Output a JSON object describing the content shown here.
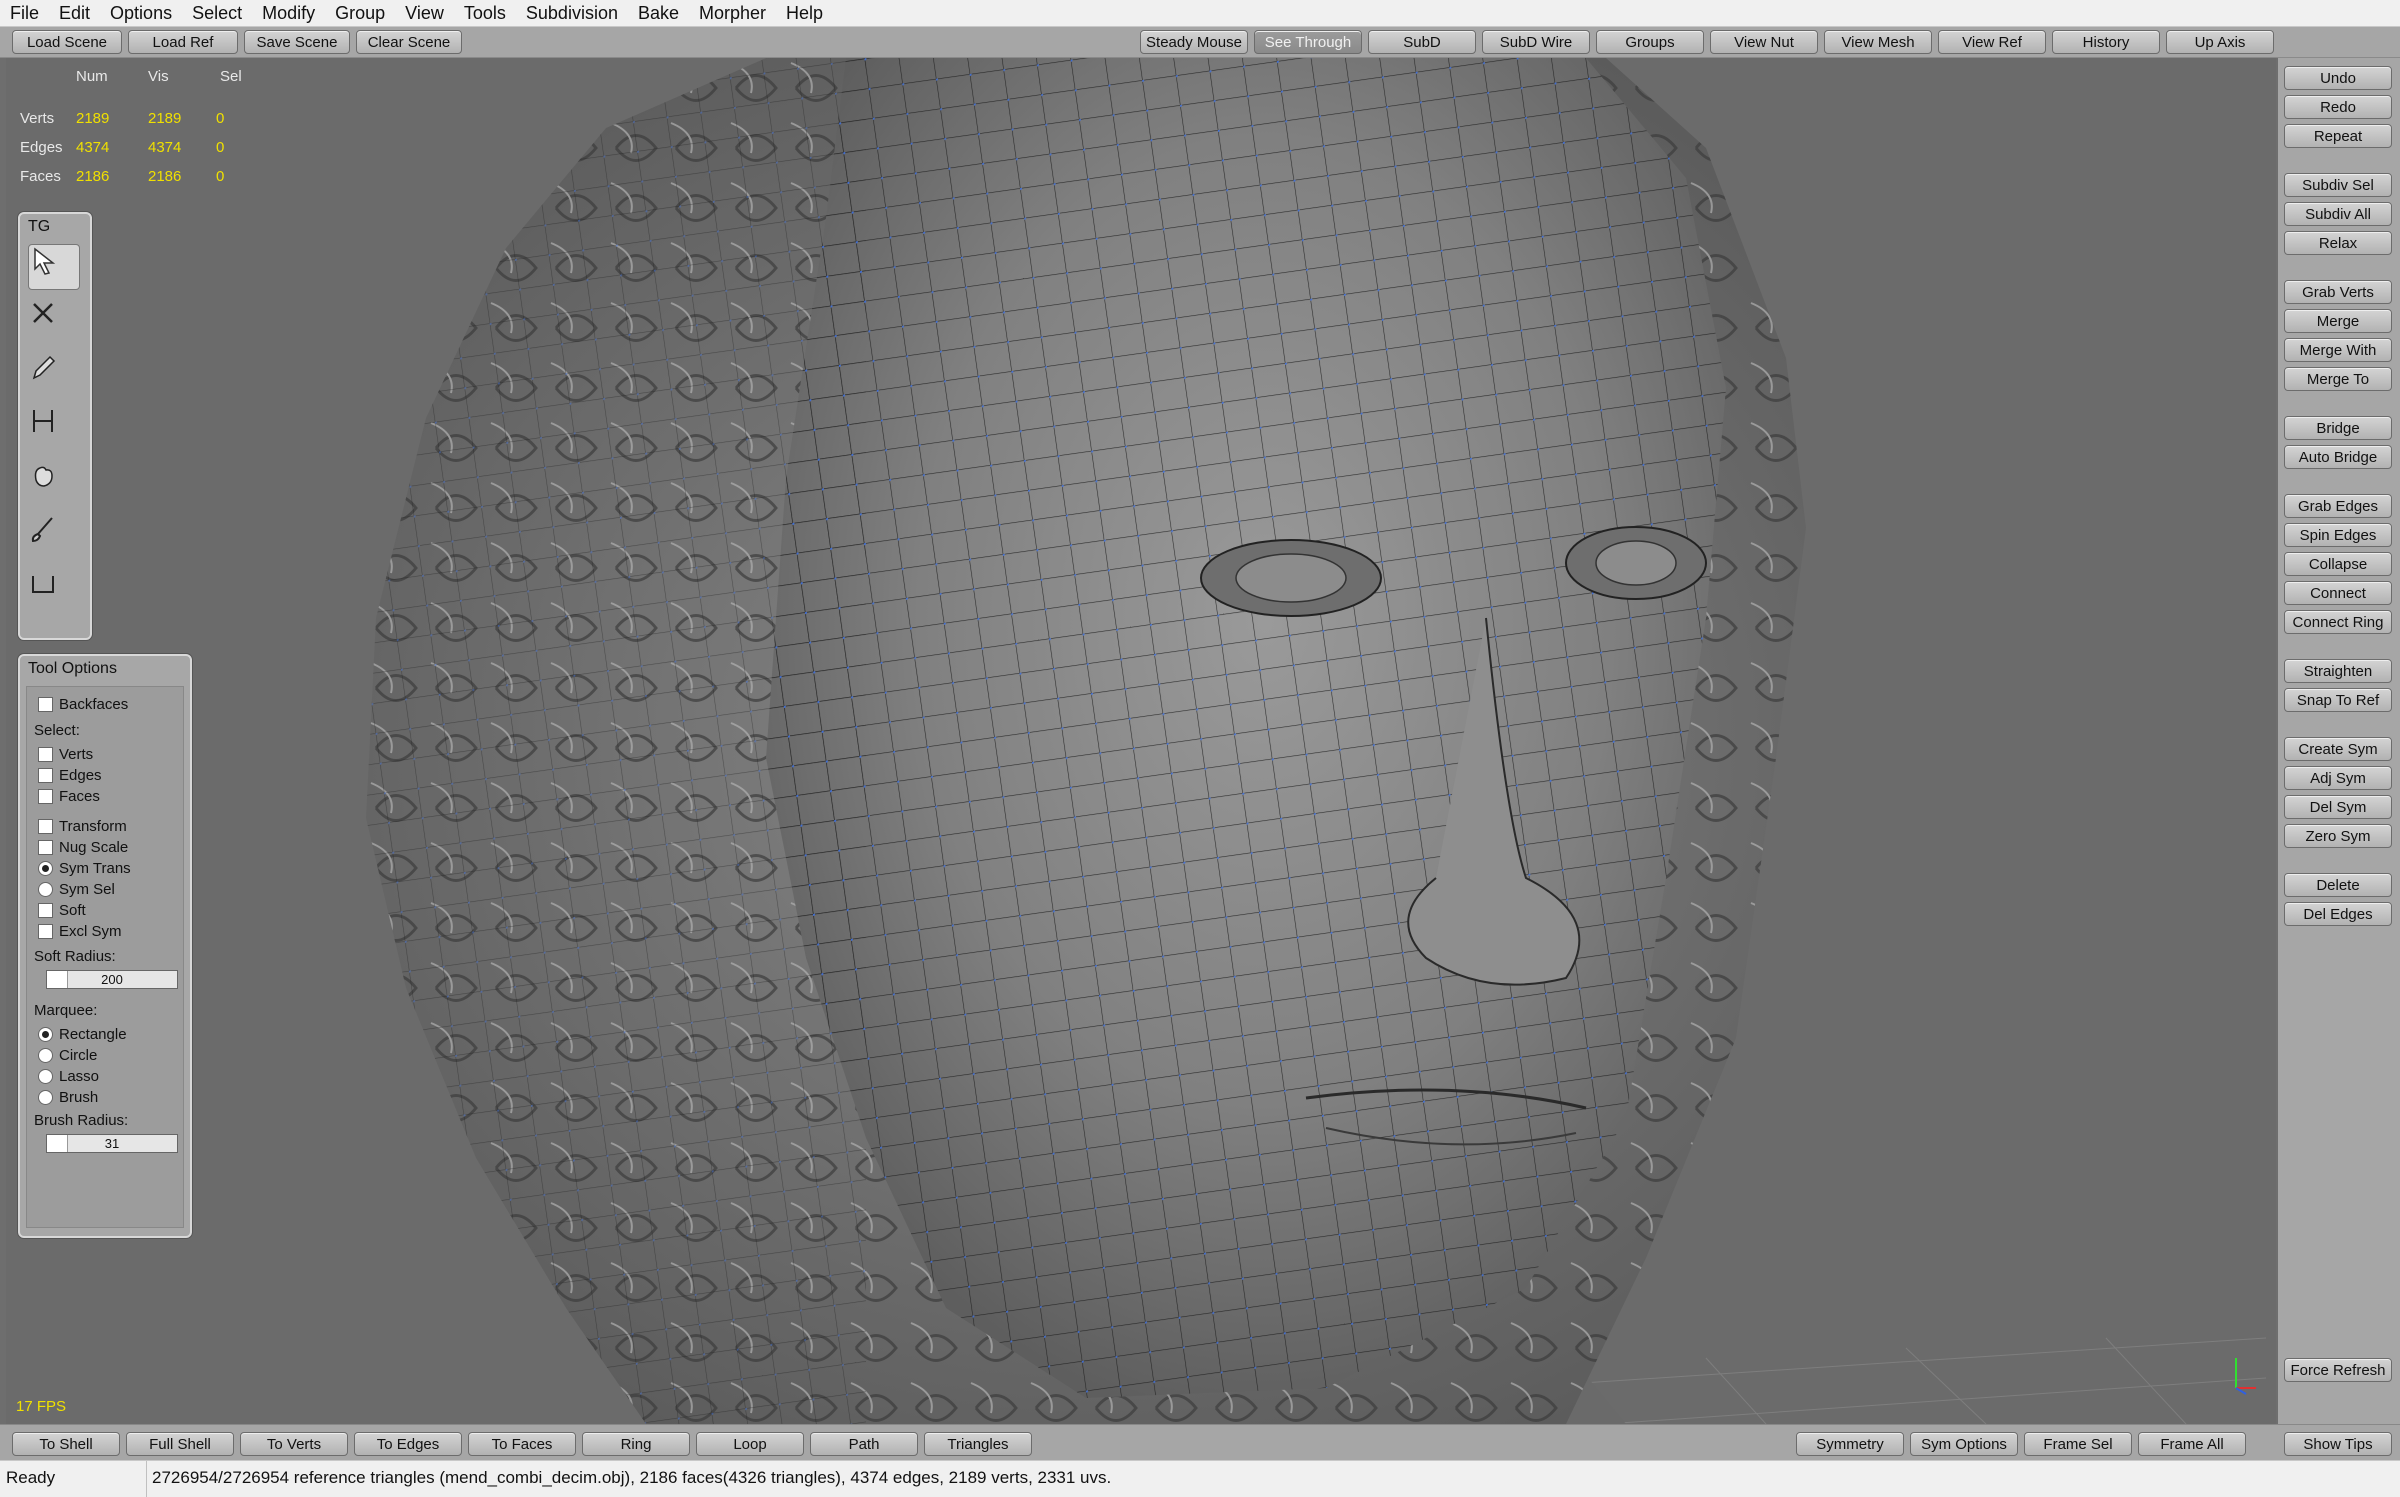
{
  "menu": [
    "File",
    "Edit",
    "Options",
    "Select",
    "Modify",
    "Group",
    "View",
    "Tools",
    "Subdivision",
    "Bake",
    "Morpher",
    "Help"
  ],
  "scene_buttons": [
    "Load Scene",
    "Load Ref",
    "Save Scene",
    "Clear Scene"
  ],
  "view_toggles": [
    "Steady Mouse",
    "See Through",
    "SubD",
    "SubD Wire",
    "Groups",
    "View Nut",
    "View Mesh",
    "View Ref",
    "History",
    "Up Axis"
  ],
  "stats": {
    "headers": [
      "Num",
      "Vis",
      "Sel"
    ],
    "rows": [
      {
        "label": "Verts",
        "num": "2189",
        "vis": "2189",
        "sel": "0"
      },
      {
        "label": "Edges",
        "num": "4374",
        "vis": "4374",
        "sel": "0"
      },
      {
        "label": "Faces",
        "num": "2186",
        "vis": "2186",
        "sel": "0"
      }
    ]
  },
  "fps": "17 FPS",
  "tool_panel": {
    "title": "TG",
    "tools": [
      "select-arrow-icon",
      "cross-icon",
      "pencil-icon",
      "bridge-tool-icon",
      "hand-tool-icon",
      "brush-tool-icon",
      "measure-tool-icon"
    ]
  },
  "tool_options": {
    "title": "Tool Options",
    "backfaces": "Backfaces",
    "select_label": "Select:",
    "select_items": [
      "Verts",
      "Edges",
      "Faces"
    ],
    "transform_items": [
      {
        "label": "Transform",
        "kind": "checkbox",
        "on": false
      },
      {
        "label": "Nug Scale",
        "kind": "checkbox",
        "on": false
      },
      {
        "label": "Sym Trans",
        "kind": "radio",
        "on": true
      },
      {
        "label": "Sym Sel",
        "kind": "radio",
        "on": false
      },
      {
        "label": "Soft",
        "kind": "checkbox",
        "on": false
      },
      {
        "label": "Excl Sym",
        "kind": "checkbox",
        "on": false
      }
    ],
    "soft_radius_label": "Soft Radius:",
    "soft_radius_value": "200",
    "marquee_label": "Marquee:",
    "marquee_items": [
      {
        "label": "Rectangle",
        "on": true
      },
      {
        "label": "Circle",
        "on": false
      },
      {
        "label": "Lasso",
        "on": false
      },
      {
        "label": "Brush",
        "on": false
      }
    ],
    "brush_radius_label": "Brush Radius:",
    "brush_radius_value": "31"
  },
  "right_buttons": [
    [
      "Undo",
      "Redo",
      "Repeat"
    ],
    [
      "Subdiv Sel",
      "Subdiv All",
      "Relax"
    ],
    [
      "Grab Verts",
      "Merge",
      "Merge With",
      "Merge To"
    ],
    [
      "Bridge",
      "Auto Bridge"
    ],
    [
      "Grab Edges",
      "Spin Edges",
      "Collapse",
      "Connect",
      "Connect Ring"
    ],
    [
      "Straighten",
      "Snap To Ref"
    ],
    [
      "Create Sym",
      "Adj Sym",
      "Del Sym",
      "Zero Sym"
    ],
    [
      "Delete",
      "Del Edges"
    ]
  ],
  "force_refresh": "Force Refresh",
  "bottom_left_buttons": [
    "To Shell",
    "Full Shell",
    "To Verts",
    "To Edges",
    "To Faces",
    "Ring",
    "Loop",
    "Path",
    "Triangles"
  ],
  "bottom_right_buttons": [
    "Symmetry",
    "Sym Options",
    "Frame Sel",
    "Frame All"
  ],
  "show_tips": "Show Tips",
  "status": {
    "ready": "Ready",
    "message": "2726954/2726954 reference triangles (mend_combi_decim.obj), 2186 faces(4326 triangles), 4374 edges, 2189 verts, 2331 uvs."
  }
}
